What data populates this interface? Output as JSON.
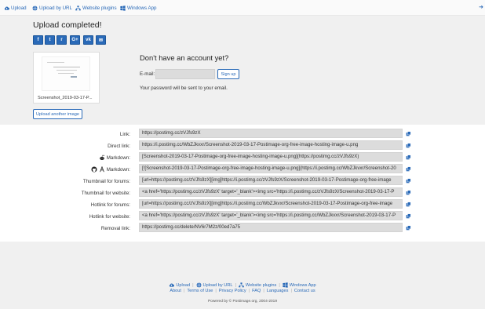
{
  "nav": {
    "items": [
      {
        "label": "Upload",
        "icon": "cloud-upload-icon"
      },
      {
        "label": "Upload by URL",
        "icon": "globe-icon"
      },
      {
        "label": "Website plugins",
        "icon": "sitemap-icon"
      },
      {
        "label": "Windows App",
        "icon": "windows-icon"
      }
    ],
    "arrow_icon": "sign-in-arrow-icon"
  },
  "main": {
    "title": "Upload completed!",
    "share": [
      {
        "icon": "facebook-icon",
        "glyph": "f"
      },
      {
        "icon": "twitter-icon",
        "glyph": "t"
      },
      {
        "icon": "reddit-icon",
        "glyph": "r"
      },
      {
        "icon": "google-plus-icon",
        "glyph": "G+"
      },
      {
        "icon": "vk-icon",
        "glyph": "vk"
      },
      {
        "icon": "email-icon",
        "glyph": "✉"
      }
    ],
    "thumbnail_caption": "Screenshot_2019-03-17-P...",
    "upload_another": "Upload another image"
  },
  "account": {
    "title": "Don't have an account yet?",
    "email_label": "E-mail:",
    "email_value": "",
    "signup_label": "Sign up",
    "password_note": "Your password will be sent to your email."
  },
  "links": [
    {
      "label": "Link:",
      "value": "https://postimg.cc/zVJfs9zX"
    },
    {
      "label": "Direct link:",
      "value": "https://i.postimg.cc/WbZJkvxr/Screenshot-2019-03-17-Postimage-org-free-image-hosting-image-u.png"
    },
    {
      "label": "Markdown:",
      "icon": "reddit-alien-icon",
      "value": "[Screenshot-2019-03-17-Postimage-org-free-image-hosting-image-u.png](https://postimg.cc/zVJfs9zX)"
    },
    {
      "label": "Markdown:",
      "icon": "github-icon",
      "icon2": "markdown-icon",
      "value": "[![Screenshot-2019-03-17-Postimage-org-free-image-hosting-image-u.png](https://i.postimg.cc/WbZJkvxr/Screenshot-20"
    },
    {
      "label": "Thumbnail for forums:",
      "value": "[url=https://postimg.cc/zVJfs9zX][img]https://i.postimg.cc/zVJfs9zX/Screenshot-2019-03-17-Postimage-org-free-image"
    },
    {
      "label": "Thumbnail for website:",
      "value": "<a href='https://postimg.cc/zVJfs9zX' target='_blank'><img src='https://i.postimg.cc/zVJfs9zX/Screenshot-2019-03-17-P"
    },
    {
      "label": "Hotlink for forums:",
      "value": "[url=https://postimg.cc/zVJfs9zX][img]https://i.postimg.cc/WbZJkvxr/Screenshot-2019-03-17-Postimage-org-free-image"
    },
    {
      "label": "Hotlink for website:",
      "value": "<a href='https://postimg.cc/zVJfs9zX' target='_blank'><img src='https://i.postimg.cc/WbZJkvxr/Screenshot-2019-03-17-P"
    },
    {
      "label": "Removal link:",
      "value": "https://postimg.cc/delete/NV6r7M2z/00ed7a75"
    }
  ],
  "copy_icon": "copy-icon",
  "footer": {
    "row1": [
      {
        "label": "Upload",
        "icon": "cloud-upload-icon"
      },
      {
        "label": "Upload by URL",
        "icon": "globe-icon"
      },
      {
        "label": "Website plugins",
        "icon": "sitemap-icon"
      },
      {
        "label": "Windows App",
        "icon": "windows-icon"
      }
    ],
    "row2": [
      "About",
      "Terms of Use",
      "Privacy Policy",
      "FAQ",
      "Languages",
      "Contact us"
    ],
    "copyright": "Powered by © Postimage.org, 2004-2019"
  },
  "colors": {
    "accent": "#2a6ab8",
    "field_bg": "#dcdcdc",
    "panel_bg": "#f0f0f0"
  }
}
